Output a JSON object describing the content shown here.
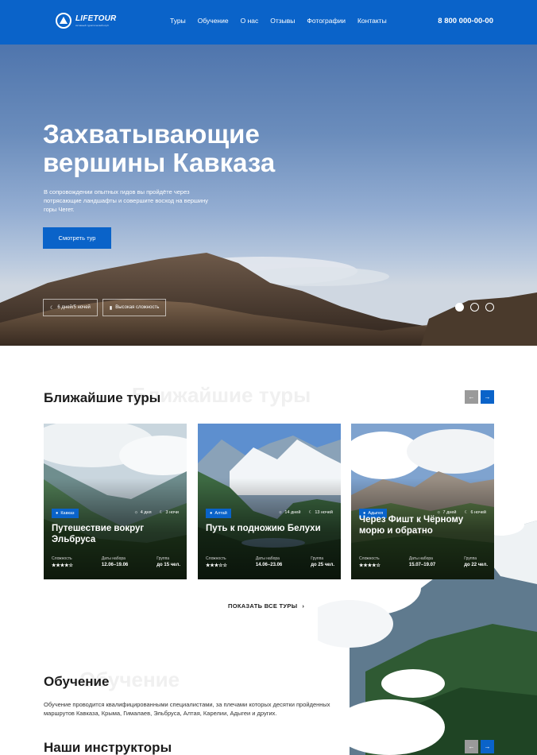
{
  "header": {
    "brand": "LIFETOUR",
    "brand_sub": "Активный туристический клуб",
    "nav": [
      "Туры",
      "Обучение",
      "О нас",
      "Отзывы",
      "Фотографии",
      "Контакты"
    ],
    "phone": "8 800 000-00-00",
    "colors": {
      "primary": "#0a63c9"
    }
  },
  "hero": {
    "title_line1": "Захватывающие",
    "title_line2": "вершины Кавказа",
    "text": "В сопровождении опытных гидов вы пройдёте через потрясающие ландшафты и совершите восход на вершину горы Чегет.",
    "button": "Смотреть тур",
    "tags": [
      "6 дней/5 ночей",
      "Высокая сложность"
    ],
    "slides": 3,
    "active_slide": 1
  },
  "tours": {
    "title": "Ближайшие туры",
    "ghost": "Ближайшие туры",
    "show_all": "ПОКАЗАТЬ ВСЕ ТУРЫ",
    "cards": [
      {
        "region": "Кавказ",
        "days": "4 дня",
        "nights": "3 ночи",
        "title": "Путешествие вокруг Эльбруса",
        "difficulty_label": "Сложность",
        "difficulty": "★★★★☆",
        "dates_label": "Даты набора",
        "dates": "12.06–19.06",
        "group_label": "Группа",
        "group": "до 15 чел."
      },
      {
        "region": "Алтай",
        "days": "14 дней",
        "nights": "13 ночей",
        "title": "Путь к подножию Белухи",
        "difficulty_label": "Сложность",
        "difficulty": "★★★☆☆",
        "dates_label": "Даты набора",
        "dates": "14.06–23.06",
        "group_label": "Группа",
        "group": "до 25 чел."
      },
      {
        "region": "Адыгея",
        "days": "7 дней",
        "nights": "6 ночей",
        "title": "Через Фишт к Чёрному морю и обратно",
        "difficulty_label": "Сложность",
        "difficulty": "★★★★☆",
        "dates_label": "Даты набора",
        "dates": "15.07–19.07",
        "group_label": "Группа",
        "group": "до 22 чел."
      }
    ]
  },
  "education": {
    "title": "Обучение",
    "ghost": "Обучение",
    "text": "Обучение проводится квалифицированными специалистами, за плечами которых десятки пройденных маршрутов Кавказа, Крыма, Гималаев, Эльбруса, Алтая, Карелии, Адыгеи и других."
  },
  "instructors": {
    "title": "Наши инструкторы"
  }
}
